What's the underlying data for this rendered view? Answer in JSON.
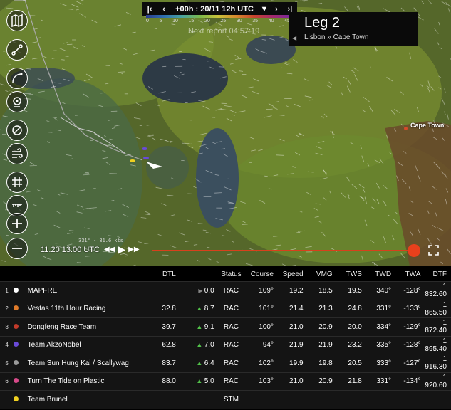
{
  "top_bar": {
    "skip_back_icon": "skip-back",
    "prev_icon": "prev",
    "time_label": "+00h : 20/11 12h UTC",
    "dropdown_icon": "caret-down",
    "next_icon": "next",
    "skip_forward_icon": "skip-forward"
  },
  "color_scale": {
    "ticks": [
      "0",
      "5",
      "10",
      "15",
      "20",
      "25",
      "30",
      "35",
      "40",
      "45"
    ]
  },
  "next_report": "Next report 04:57:19",
  "leg": {
    "title": "Leg 2",
    "route": "Lisbon » Cape Town"
  },
  "map": {
    "cape_town_label": "Cape Town",
    "boat_readout": "331° - 31.6 kts",
    "timeline_date": "11.20 13:00 UTC"
  },
  "toolbar": {
    "tools": [
      "map-icon",
      "route-icon",
      "arc-icon",
      "compass-icon",
      "no-wind-icon",
      "wind-icon",
      "grid-icon",
      "ruler-icon",
      "zoom-in-icon",
      "zoom-out-icon"
    ]
  },
  "table": {
    "headers": [
      "DTL",
      "Status",
      "Course",
      "Speed",
      "VMG",
      "TWS",
      "TWD",
      "TWA",
      "DTF"
    ],
    "rows": [
      {
        "rank": "1",
        "color": "#ffffff",
        "name": "MAPFRE",
        "dtl": "",
        "trend": "eq",
        "delta": "0.0",
        "status": "RAC",
        "course": "109°",
        "speed": "19.2",
        "vmg": "18.5",
        "tws": "19.5",
        "twd": "340°",
        "twa": "-128°",
        "dtf": "1 832.60"
      },
      {
        "rank": "2",
        "color": "#e07b2a",
        "name": "Vestas 11th Hour Racing",
        "dtl": "32.8",
        "trend": "up",
        "delta": "8.7",
        "status": "RAC",
        "course": "101°",
        "speed": "21.4",
        "vmg": "21.3",
        "tws": "24.8",
        "twd": "331°",
        "twa": "-133°",
        "dtf": "1 865.50"
      },
      {
        "rank": "3",
        "color": "#c23a2a",
        "name": "Dongfeng Race Team",
        "dtl": "39.7",
        "trend": "up",
        "delta": "9.1",
        "status": "RAC",
        "course": "100°",
        "speed": "21.0",
        "vmg": "20.9",
        "tws": "20.0",
        "twd": "334°",
        "twa": "-129°",
        "dtf": "1 872.40"
      },
      {
        "rank": "4",
        "color": "#6a4ad8",
        "name": "Team AkzoNobel",
        "dtl": "62.8",
        "trend": "up",
        "delta": "7.0",
        "status": "RAC",
        "course": "94°",
        "speed": "21.9",
        "vmg": "21.9",
        "tws": "23.2",
        "twd": "335°",
        "twa": "-128°",
        "dtf": "1 895.40"
      },
      {
        "rank": "5",
        "color": "#9a9a9a",
        "name": "Team Sun Hung Kai / Scallywag",
        "dtl": "83.7",
        "trend": "up",
        "delta": "6.4",
        "status": "RAC",
        "course": "102°",
        "speed": "19.9",
        "vmg": "19.8",
        "tws": "20.5",
        "twd": "333°",
        "twa": "-127°",
        "dtf": "1 916.30"
      },
      {
        "rank": "6",
        "color": "#d84a8a",
        "name": "Turn The Tide on Plastic",
        "dtl": "88.0",
        "trend": "up",
        "delta": "5.0",
        "status": "RAC",
        "course": "103°",
        "speed": "21.0",
        "vmg": "20.9",
        "tws": "21.8",
        "twd": "331°",
        "twa": "-134°",
        "dtf": "1 920.60"
      },
      {
        "rank": "",
        "color": "#f0d020",
        "name": "Team Brunel",
        "dtl": "",
        "trend": "",
        "delta": "",
        "status": "STM",
        "course": "",
        "speed": "",
        "vmg": "",
        "tws": "",
        "twd": "",
        "twa": "",
        "dtf": ""
      }
    ]
  }
}
